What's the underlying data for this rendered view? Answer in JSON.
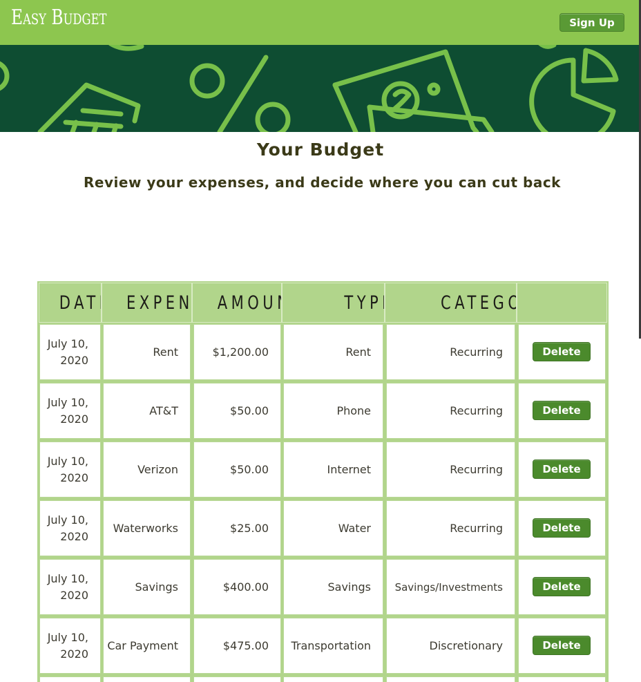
{
  "navbar": {
    "brand": "Easy Budget",
    "signup_label": "Sign Up"
  },
  "banner": {
    "icons": [
      "bank-icon",
      "percent-icon",
      "money-icon",
      "pie-chart-icon"
    ]
  },
  "colors": {
    "navbar": "#8dc64f",
    "banner": "#0e4d32",
    "table_header": "#b1d58b",
    "button": "#4b8a2c",
    "text": "#3b3a18"
  },
  "page": {
    "title": "Your Budget",
    "subtitle": "Review your expenses, and decide where you can cut back"
  },
  "table": {
    "columns": [
      "Date",
      "Expense",
      "Amount",
      "Type",
      "Category",
      ""
    ],
    "rows": [
      {
        "date": "July 10, 2020",
        "expense": "Rent",
        "amount": "$1,200.00",
        "type": "Rent",
        "category": "Recurring",
        "action": "Delete"
      },
      {
        "date": "July 10, 2020",
        "expense": "AT&T",
        "amount": "$50.00",
        "type": "Phone",
        "category": "Recurring",
        "action": "Delete"
      },
      {
        "date": "July 10, 2020",
        "expense": "Verizon",
        "amount": "$50.00",
        "type": "Internet",
        "category": "Recurring",
        "action": "Delete"
      },
      {
        "date": "July 10, 2020",
        "expense": "Waterworks",
        "amount": "$25.00",
        "type": "Water",
        "category": "Recurring",
        "action": "Delete"
      },
      {
        "date": "July 10, 2020",
        "expense": "Savings",
        "amount": "$400.00",
        "type": "Savings",
        "category": "Savings/Investments",
        "action": "Delete"
      },
      {
        "date": "July 10, 2020",
        "expense": "Car Payment",
        "amount": "$475.00",
        "type": "Transportation",
        "category": "Discretionary",
        "action": "Delete"
      }
    ]
  }
}
